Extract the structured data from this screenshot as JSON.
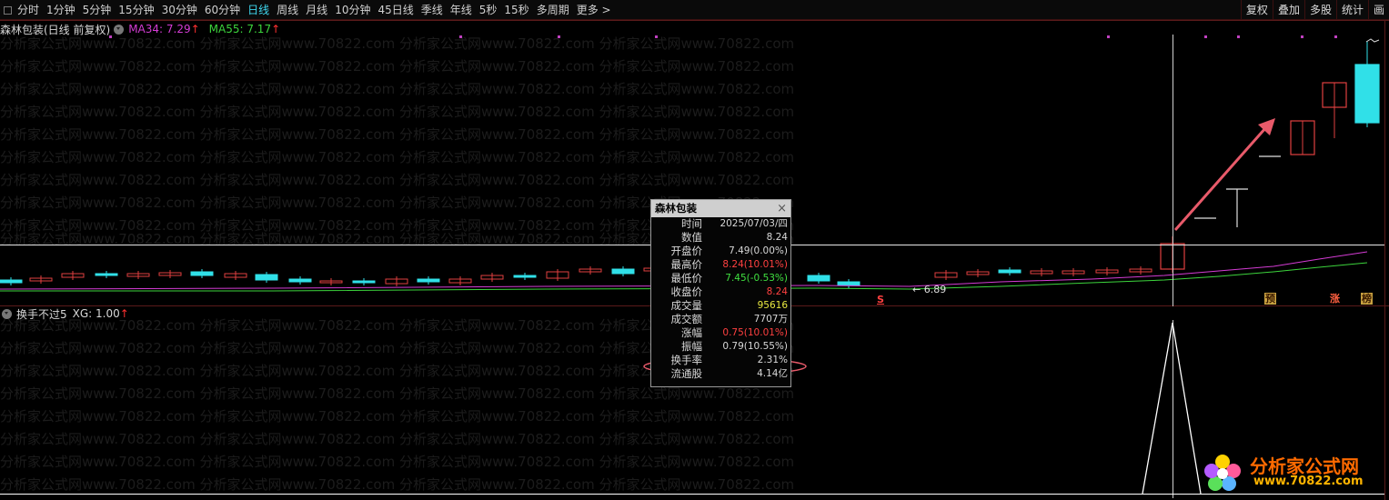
{
  "toolbar": {
    "periods": [
      {
        "label": "分时",
        "active": false
      },
      {
        "label": "1分钟",
        "active": false
      },
      {
        "label": "5分钟",
        "active": false
      },
      {
        "label": "15分钟",
        "active": false
      },
      {
        "label": "30分钟",
        "active": false
      },
      {
        "label": "60分钟",
        "active": false
      },
      {
        "label": "日线",
        "active": true
      },
      {
        "label": "周线",
        "active": false
      },
      {
        "label": "月线",
        "active": false
      },
      {
        "label": "10分钟",
        "active": false
      },
      {
        "label": "45日线",
        "active": false
      },
      {
        "label": "季线",
        "active": false
      },
      {
        "label": "年线",
        "active": false
      },
      {
        "label": "5秒",
        "active": false
      },
      {
        "label": "15秒",
        "active": false
      },
      {
        "label": "多周期",
        "active": false
      },
      {
        "label": "更多 >",
        "active": false
      }
    ],
    "right_tools": [
      "复权",
      "叠加",
      "多股",
      "统计",
      "画"
    ]
  },
  "main_chart": {
    "title": "森林包装(日线 前复权)",
    "ma34_label": "MA34: 7.29",
    "ma55_label": "MA55: 7.17",
    "up_arrow": "↑",
    "low_annotation": "← 6.89",
    "colors": {
      "ma34": "#d43cd4",
      "ma55": "#3cd43c",
      "up": "#e04040",
      "down": "#30e0e8"
    }
  },
  "sub_chart": {
    "title": "换手不过5",
    "xg_label": "XG: 1.00",
    "up_arrow": "↑"
  },
  "markers": {
    "s": "S",
    "yu": "预",
    "zhang": "涨",
    "bang": "榜"
  },
  "tooltip": {
    "stock_name": "森林包装",
    "close_icon": "×",
    "rows": [
      {
        "label": "时间",
        "value": "2025/07/03/四",
        "color": "#d8d8d8"
      },
      {
        "label": "数值",
        "value": "8.24",
        "color": "#d8d8d8"
      },
      {
        "label": "开盘价",
        "value": "7.49(0.00%)",
        "color": "#d8d8d8"
      },
      {
        "label": "最高价",
        "value": "8.24(10.01%)",
        "color": "#ff4040"
      },
      {
        "label": "最低价",
        "value": "7.45(-0.53%)",
        "color": "#40e040"
      },
      {
        "label": "收盘价",
        "value": "8.24",
        "color": "#ff4040"
      },
      {
        "label": "成交量",
        "value": "95616",
        "color": "#e8e840"
      },
      {
        "label": "成交额",
        "value": "7707万",
        "color": "#d8d8d8"
      },
      {
        "label": "涨幅",
        "value": "0.75(10.01%)",
        "color": "#ff4040"
      },
      {
        "label": "振幅",
        "value": "0.79(10.55%)",
        "color": "#d8d8d8"
      },
      {
        "label": "换手率",
        "value": "2.31%",
        "color": "#d8d8d8"
      },
      {
        "label": "流通股",
        "value": "4.14亿",
        "color": "#d8d8d8"
      }
    ]
  },
  "watermark": {
    "text": "分析家公式网www.70822.com"
  },
  "logo": {
    "main": "分析家公式网",
    "url": "www.70822.com"
  }
}
